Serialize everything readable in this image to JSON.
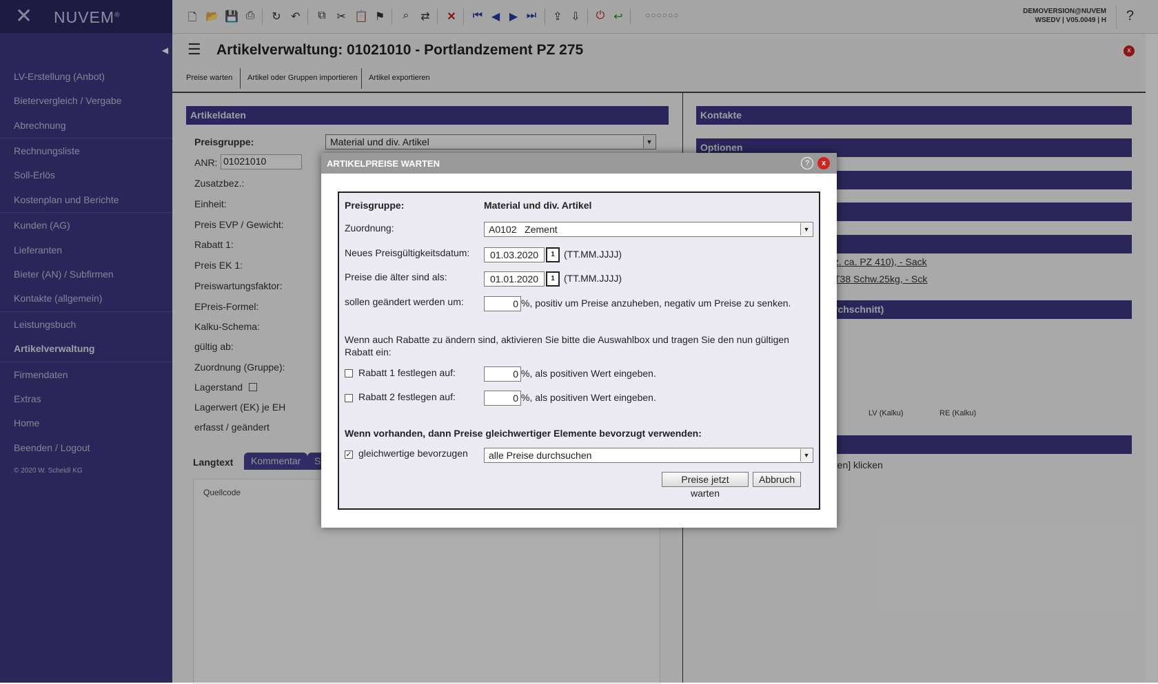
{
  "app": {
    "brand": "NUVEM",
    "brand_mark": "®"
  },
  "sidebar": {
    "items": [
      {
        "label": "LV-Erstellung (Anbot)"
      },
      {
        "label": "Bietervergleich / Vergabe"
      },
      {
        "label": "Abrechnung"
      },
      {
        "label": "Rechnungsliste"
      },
      {
        "label": "Soll-Erlös"
      },
      {
        "label": "Kostenplan und Berichte"
      },
      {
        "label": "Kunden (AG)"
      },
      {
        "label": "Lieferanten"
      },
      {
        "label": "Bieter (AN) / Subfirmen"
      },
      {
        "label": "Kontakte (allgemein)"
      },
      {
        "label": "Leistungsbuch"
      },
      {
        "label": "Artikelverwaltung"
      },
      {
        "label": "Firmendaten"
      },
      {
        "label": "Extras"
      },
      {
        "label": "Home"
      },
      {
        "label": "Beenden / Logout"
      }
    ],
    "copyright": "© 2020 W. Scheidl KG"
  },
  "topbar": {
    "user": "DEMOVERSION@NUVEM",
    "version": "WSEDV | V05.0049 | H",
    "help": "?",
    "dots": "○○○○○○"
  },
  "page": {
    "title": "Artikelverwaltung: 01021010 - Portlandzement PZ 275",
    "close": "x",
    "tabs": [
      "Preise warten",
      "Artikel oder Gruppen importieren",
      "Artikel exportieren"
    ]
  },
  "artikeldaten": {
    "header": "Artikeldaten",
    "preisgruppe_label": "Preisgruppe:",
    "preisgruppe_value": "Material und div. Artikel",
    "anr_label": "ANR:",
    "anr_value": "01021010",
    "fields": [
      "Zusatzbez.:",
      "Einheit:",
      "Preis EVP / Gewicht:",
      "Rabatt 1:",
      "Preis EK 1:",
      "Preiswartungsfaktor:",
      "EPreis-Formel:",
      "Kalku-Schema:",
      "gültig ab:",
      "Zuordnung (Gruppe):",
      "Lagerstand",
      "Lagerwert (EK) je EH",
      "erfasst / geändert"
    ]
  },
  "text_tabs": {
    "langtext": "Langtext",
    "kommentar": "Kommentar",
    "third": "S",
    "quellcode": "Quellcode"
  },
  "right_panels": {
    "kontakte": "Kontakte",
    "optionen": "Optionen",
    "link1": "z. ca. PZ 410), - Sack",
    "link2": "T38 Schw.25kg, - Sck",
    "chart_title": "rchschnitt)",
    "legend_lv": "LV (Kalku)",
    "legend_re": "RE (Kalku)",
    "hint": "ren] klicken"
  },
  "modal": {
    "title": "ARTIKELPREISE WARTEN",
    "help": "?",
    "close": "x",
    "preisgruppe_label": "Preisgruppe:",
    "preisgruppe_value": "Material und div. Artikel",
    "zuordnung_label": "Zuordnung:",
    "zuordnung_value": "A0102   Zement",
    "datum_label": "Neues Preisgültigkeitsdatum:",
    "datum_value": "01.03.2020",
    "datum_format": "(TT.MM.JJJJ)",
    "aelter_label": "Preise die älter sind als:",
    "aelter_value": "01.01.2020",
    "aelter_format": "(TT.MM.JJJJ)",
    "cal_icon": "1",
    "aendern_label": "sollen geändert werden um:",
    "aendern_value": "0",
    "aendern_hint": "%, positiv um Preise anzuheben, negativ um Preise zu senken.",
    "rabatt_info": "Wenn auch Rabatte zu ändern sind, aktivieren Sie bitte die Auswahlbox und tragen Sie den nun gültigen Rabatt ein:",
    "rabatt1_label": "Rabatt 1 festlegen auf:",
    "rabatt1_value": "0",
    "rabatt1_hint": "%, als positiven Wert eingeben.",
    "rabatt2_label": "Rabatt 2 festlegen auf:",
    "rabatt2_value": "0",
    "rabatt2_hint": "%, als positiven Wert eingeben.",
    "gleichwertig_heading": "Wenn vorhanden, dann Preise gleichwertiger Elemente bevorzugt verwenden:",
    "gleichwertig_label": "gleichwertige bevorzugen",
    "gleichwertig_checked": "✓",
    "gleichwertig_select": "alle Preise durchsuchen",
    "ok_button": "Preise jetzt warten",
    "cancel_button": "Abbruch"
  }
}
